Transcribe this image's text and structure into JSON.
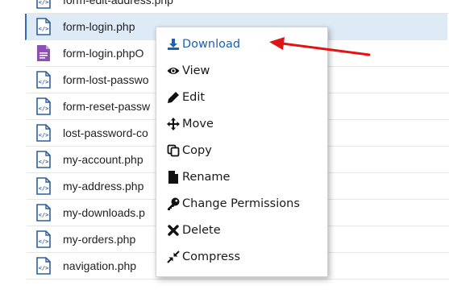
{
  "files": [
    {
      "name": "form-edit-address.php",
      "icon": "php-file-icon"
    },
    {
      "name": "form-login.php",
      "icon": "php-file-icon",
      "selected": true
    },
    {
      "name": "form-login.phpO",
      "icon": "generic-file-icon"
    },
    {
      "name": "form-lost-passwo",
      "icon": "php-file-icon"
    },
    {
      "name": "form-reset-passw",
      "icon": "php-file-icon"
    },
    {
      "name": "lost-password-co",
      "icon": "php-file-icon"
    },
    {
      "name": "my-account.php",
      "icon": "php-file-icon"
    },
    {
      "name": "my-address.php",
      "icon": "php-file-icon"
    },
    {
      "name": "my-downloads.p",
      "icon": "php-file-icon"
    },
    {
      "name": "my-orders.php",
      "icon": "php-file-icon"
    },
    {
      "name": "navigation.php",
      "icon": "php-file-icon"
    }
  ],
  "context_menu": {
    "items": [
      {
        "label": "Download",
        "icon": "download-icon"
      },
      {
        "label": "View",
        "icon": "eye-icon"
      },
      {
        "label": "Edit",
        "icon": "pencil-icon"
      },
      {
        "label": "Move",
        "icon": "move-icon"
      },
      {
        "label": "Copy",
        "icon": "copy-icon"
      },
      {
        "label": "Rename",
        "icon": "file-icon"
      },
      {
        "label": "Change Permissions",
        "icon": "key-icon"
      },
      {
        "label": "Delete",
        "icon": "x-icon"
      },
      {
        "label": "Compress",
        "icon": "compress-icon"
      }
    ]
  },
  "colors": {
    "accent": "#1d5fb0",
    "selected_row": "#dfeaf7",
    "annotation_arrow": "#e01414",
    "php_icon": "#2f5f99",
    "generic_file_icon": "#8e4fb3"
  }
}
